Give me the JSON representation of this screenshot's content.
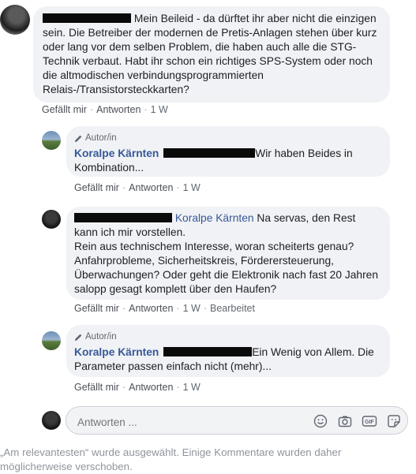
{
  "comments": [
    {
      "text": "Mein Beileid - da dürftet ihr aber nicht die einzigen sein. Die Betreiber der modernen de Pretis-Anlagen stehen über kurz oder lang vor dem selben Problem, die haben auch alle die STG-Technik verbaut. Habt ihr schon ein richtiges SPS-System oder noch die altmodischen verbindungsprogrammierten Relais-/Transistorsteckkarten?",
      "like": "Gefällt mir",
      "reply": "Antworten",
      "time": "1 W"
    },
    {
      "author_tag": "Autor/in",
      "author": "Koralpe Kärnten",
      "text": "Wir haben Beides in Kombination...",
      "like": "Gefällt mir",
      "reply": "Antworten",
      "time": "1 W"
    },
    {
      "mention": "Koralpe Kärnten",
      "text_after_mention": " Na servas, den Rest kann ich mir vorstellen.",
      "text_2": "Rein aus technischem Interesse, woran scheiterts genau? Anfahrprobleme, Sicherheitskreis, Förderersteuerung, Überwachungen? Oder geht die Elektronik nach fast 20 Jahren salopp gesagt komplett über den Haufen?",
      "like": "Gefällt mir",
      "reply": "Antworten",
      "time": "1 W",
      "edited": "Bearbeitet"
    },
    {
      "author_tag": "Autor/in",
      "author": "Koralpe Kärnten",
      "text": "Ein Wenig von Allem. Die Parameter passen einfach nicht (mehr)...",
      "like": "Gefällt mir",
      "reply": "Antworten",
      "time": "1 W"
    }
  ],
  "reply_input": {
    "placeholder": "Antworten ...",
    "tools": [
      "emoji-icon",
      "camera-icon",
      "gif-icon",
      "sticker-icon"
    ]
  },
  "footer_note": "„Am relevantesten“ wurde ausgewählt. Einige Kommentare wurden daher möglicherweise verschoben.",
  "colors": {
    "bubble": "#f0f2f5",
    "link": "#385898",
    "meta": "#606770"
  }
}
